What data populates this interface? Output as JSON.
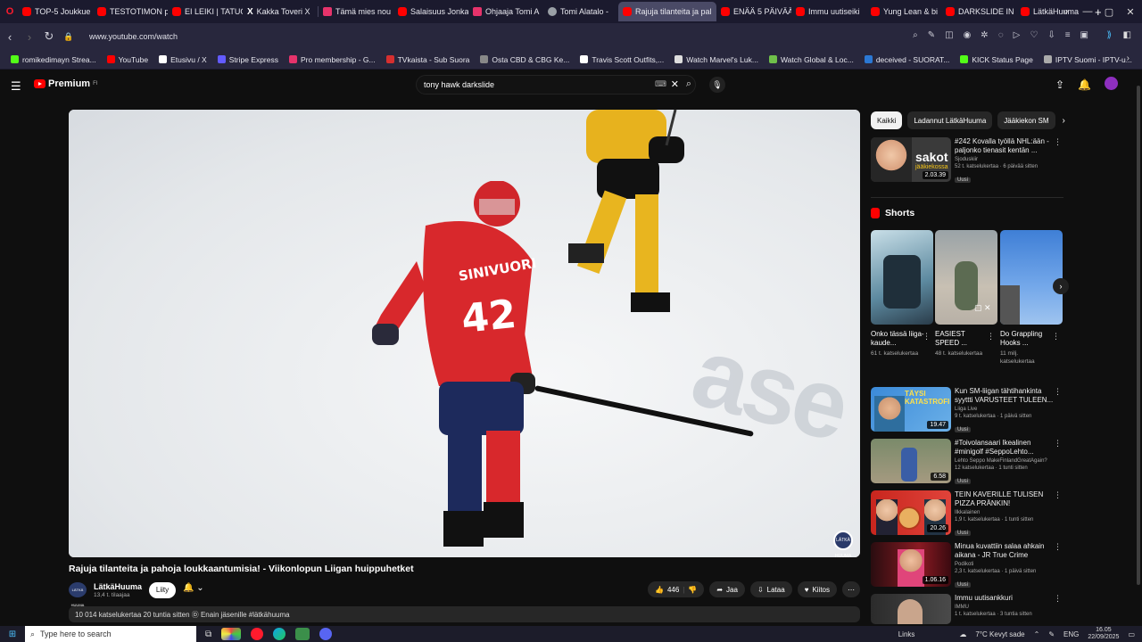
{
  "browser": {
    "tabs": [
      {
        "title": "TOP-5 Joukkue",
        "icon": "opera-icon"
      },
      {
        "title": "TESTOTIMON p",
        "icon": "youtube-icon"
      },
      {
        "title": "EI LEIKI | TATUO",
        "icon": "youtube-icon"
      },
      {
        "title": "Kakka Toveri X",
        "icon": "x-icon"
      },
      {
        "title": "Tämä mies nou",
        "icon": "tab-icon"
      },
      {
        "title": "Salaisuus Jonka",
        "icon": "youtube-icon"
      },
      {
        "title": "Ohjaaja Tomi A",
        "icon": "tab-icon"
      },
      {
        "title": "Tomi Alatalo -",
        "icon": "google-icon"
      },
      {
        "title": "Rajuja tilanteita ja pal",
        "icon": "youtube-icon",
        "active": true
      },
      {
        "title": "ENÄÄ 5 PÄIVÄÄ",
        "icon": "youtube-icon"
      },
      {
        "title": "Immu uutiseiki",
        "icon": "youtube-icon"
      },
      {
        "title": "Yung Lean & bi",
        "icon": "youtube-icon"
      },
      {
        "title": "DARKSLIDE IN",
        "icon": "youtube-icon"
      },
      {
        "title": "LätkäHuuma",
        "icon": "youtube-icon"
      }
    ],
    "url": "www.youtube.com/watch",
    "bookmarks": [
      {
        "label": "romikedimayn Strea...",
        "color": "#53fc18"
      },
      {
        "label": "YouTube",
        "color": "#ff0000"
      },
      {
        "label": "Etusivu / X",
        "color": "#ffffff"
      },
      {
        "label": "Stripe Express",
        "color": "#635bff"
      },
      {
        "label": "Pro membership - G...",
        "color": "#e6336b"
      },
      {
        "label": "TVkaista - Sub Suora",
        "color": "#d62f2f"
      },
      {
        "label": "Osta CBD & CBG Ke...",
        "color": "#888888"
      },
      {
        "label": "Travis Scott Outfits,...",
        "color": "#ffffff"
      },
      {
        "label": "Watch Marvel's Luk...",
        "color": "#dddddd"
      },
      {
        "label": "Watch Global & Loc...",
        "color": "#6fbf4a"
      },
      {
        "label": "deceived - SUORAT...",
        "color": "#2b78d4"
      },
      {
        "label": "KICK Status Page",
        "color": "#53fc18"
      },
      {
        "label": "IPTV Suomi - IPTV-u...",
        "color": "#aaaaaa"
      }
    ]
  },
  "yt": {
    "logo_text": "Premium",
    "logo_sup": "FI",
    "search_value": "tony hawk darkslide"
  },
  "video": {
    "title": "Rajuja tilanteita ja pahoja loukkaantumisia! - Viikonlopun Liigan huippuhetket",
    "channel_name": "LätkäHuuma",
    "channel_subs": "13,4 t. tilaajaa",
    "channel_logo": "LÄTKÄ HUUMA",
    "join_label": "Liity",
    "likes": "446",
    "share_label": "Jaa",
    "download_label": "Lataa",
    "thanks_label": "Kiitos",
    "description": "10 014 katselukertaa  20 tuntia sitten  Ⓓ Enain jäsenille #lätkähuuma",
    "jersey_name": "SINIVUORI",
    "jersey_number": "42"
  },
  "sidebar": {
    "chips": [
      "Kaikki",
      "Ladannut LätkäHuuma",
      "Jääkiekon SM"
    ],
    "top": {
      "title": "#242 Kovalla työllä NHL:ään - paljonko tienasit kentän ...",
      "channel": "Sjoduskiir",
      "meta": "52 t. katselukertaa · 6 päivää sitten",
      "badge": "Uusi",
      "duration": "2.03.39",
      "thumb_text": "sakot",
      "thumb_sub": "jääkiekossa"
    },
    "shorts_label": "Shorts",
    "shorts": [
      {
        "title": "Onko tässä liiga-kaude...",
        "views": "61 t. katselukertaa"
      },
      {
        "title": "EASIEST SPEED ...",
        "views": "48 t. katselukertaa"
      },
      {
        "title": "Do Grappling Hooks ...",
        "views": "11 milj. katselukertaa"
      }
    ],
    "recs": [
      {
        "title": "Kun SM-liigan tähtihankinta syyttti VARUSTEET TULEEN...",
        "channel": "Liiga Live",
        "meta": "9 t. katselukertaa · 1 päivä sitten",
        "badge": "Uusi",
        "duration": "19.47",
        "thumb_text": "TÄYSI KATASTROFI"
      },
      {
        "title": "#Toivolansaari Ikealinen #minigolf #SeppoLehto...",
        "channel": "Lehto Seppo MakeFinlandGreatAgain?",
        "meta": "12 katselukertaa · 1 tunti sitten",
        "badge": "Uusi",
        "duration": "6.58",
        "thumb_text": ""
      },
      {
        "title": "TEIN KAVERILLE TULISEN PIZZA PRÄNKIN!",
        "channel": "Ilkkalainen",
        "meta": "1,9 t. katselukertaa · 1 tunti sitten",
        "badge": "Uusi",
        "duration": "20.26",
        "thumb_text": ""
      },
      {
        "title": "Minua kuvattiin salaa ahkain aikana - JR True Crime  podca...",
        "channel": "Podikoti",
        "meta": "2,3 t. katselukertaa · 1 päivä sitten",
        "badge": "Uusi",
        "duration": "1.06.16",
        "thumb_text": ""
      },
      {
        "title": "Immu uutisankkuri",
        "channel": "IMMU",
        "meta": "1 t. katselukertaa · 3 tuntia sitten",
        "badge": "",
        "duration": "",
        "thumb_text": ""
      }
    ]
  },
  "taskbar": {
    "search_placeholder": "Type here to search",
    "links_label": "Links",
    "weather": "7°C  Kevyt sade",
    "lang": "ENG",
    "time": "16.05",
    "date": "22/09/2025"
  }
}
